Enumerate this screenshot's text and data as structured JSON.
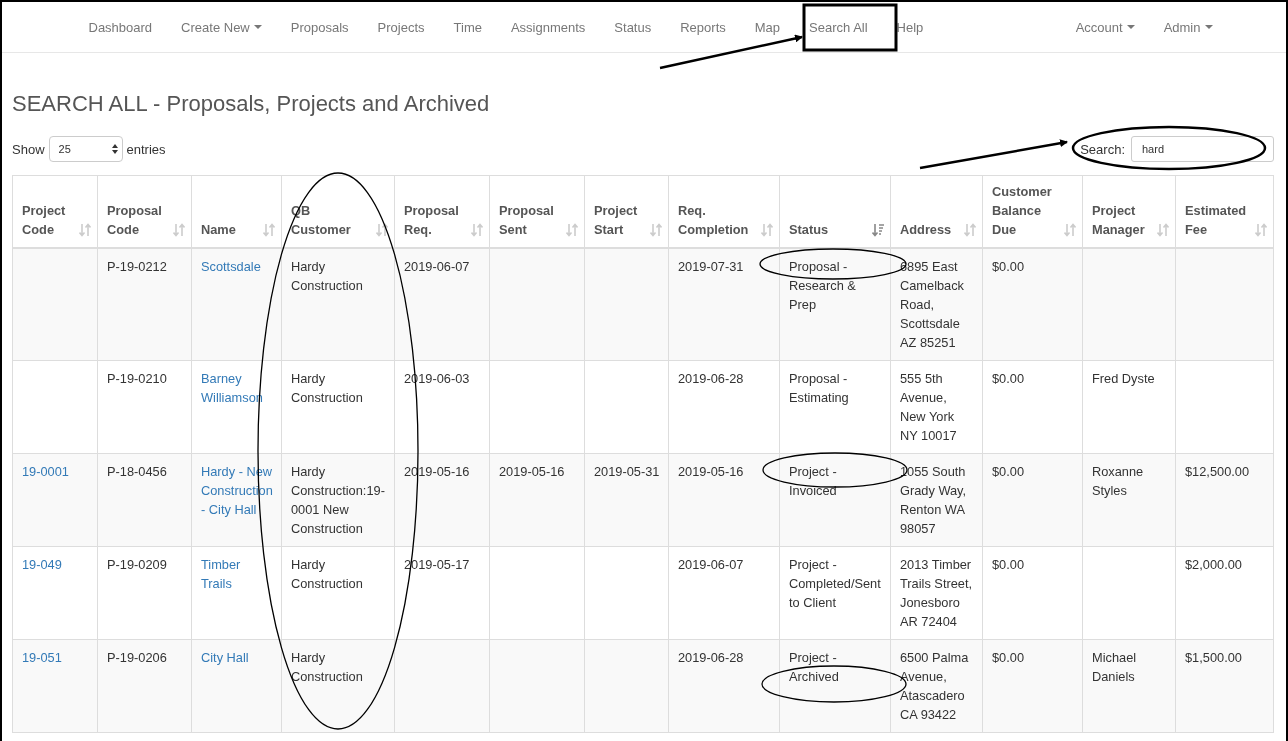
{
  "nav": {
    "items": [
      {
        "label": "Dashboard",
        "dropdown": false
      },
      {
        "label": "Create New",
        "dropdown": true
      },
      {
        "label": "Proposals",
        "dropdown": false
      },
      {
        "label": "Projects",
        "dropdown": false
      },
      {
        "label": "Time",
        "dropdown": false
      },
      {
        "label": "Assignments",
        "dropdown": false
      },
      {
        "label": "Status",
        "dropdown": false
      },
      {
        "label": "Reports",
        "dropdown": false
      },
      {
        "label": "Map",
        "dropdown": false
      },
      {
        "label": "Search All",
        "dropdown": false
      },
      {
        "label": "Help",
        "dropdown": false
      }
    ],
    "right_items": [
      {
        "label": "Account",
        "dropdown": true
      },
      {
        "label": "Admin",
        "dropdown": true
      }
    ]
  },
  "page_title": "SEARCH ALL - Proposals, Projects and Archived",
  "length_control": {
    "label_before": "Show",
    "value": "25",
    "label_after": "entries"
  },
  "search": {
    "label": "Search:",
    "value": "hard"
  },
  "table": {
    "columns": [
      {
        "label": "Project Code",
        "sorted": false
      },
      {
        "label": "Proposal Code",
        "sorted": false
      },
      {
        "label": "Name",
        "sorted": false
      },
      {
        "label": "QB Customer",
        "sorted": false
      },
      {
        "label": "Proposal Req.",
        "sorted": false
      },
      {
        "label": "Proposal Sent",
        "sorted": false
      },
      {
        "label": "Project Start",
        "sorted": false
      },
      {
        "label": "Req. Completion",
        "sorted": false
      },
      {
        "label": "Status",
        "sorted": true
      },
      {
        "label": "Address",
        "sorted": false
      },
      {
        "label": "Customer Balance Due",
        "sorted": false
      },
      {
        "label": "Project Manager",
        "sorted": false
      },
      {
        "label": "Estimated Fee",
        "sorted": false
      }
    ],
    "rows": [
      {
        "proposal_code": "P-19-0212",
        "name": "Scottsdale",
        "qb_customer": "Hardy Construction",
        "proposal_req": "2019-06-07",
        "req_completion": "2019-07-31",
        "status": "Proposal - Research & Prep",
        "address": "6895 East Camelback Road, Scottsdale AZ 85251",
        "balance_due": "$0.00"
      },
      {
        "proposal_code": "P-19-0210",
        "name": "Barney Williamson",
        "qb_customer": "Hardy Construction",
        "proposal_req": "2019-06-03",
        "req_completion": "2019-06-28",
        "status": "Proposal - Estimating",
        "address": "555 5th Avenue, New York NY 10017",
        "balance_due": "$0.00",
        "project_manager": "Fred Dyste"
      },
      {
        "project_code": "19-0001",
        "proposal_code": "P-18-0456",
        "name": "Hardy - New Construction - City Hall",
        "qb_customer": "Hardy Construction:19-0001 New Construction",
        "proposal_req": "2019-05-16",
        "proposal_sent": "2019-05-16",
        "project_start": "2019-05-31",
        "req_completion": "2019-05-16",
        "status": "Project - Invoiced",
        "address": "1055 South Grady Way, Renton WA 98057",
        "balance_due": "$0.00",
        "project_manager": "Roxanne Styles",
        "estimated_fee": "$12,500.00"
      },
      {
        "project_code": "19-049",
        "proposal_code": "P-19-0209",
        "name": "Timber Trails",
        "qb_customer": "Hardy Construction",
        "proposal_req": "2019-05-17",
        "req_completion": "2019-06-07",
        "status": "Project - Completed/Sent to Client",
        "address": "2013 Timber Trails Street, Jonesboro AR 72404",
        "balance_due": "$0.00",
        "estimated_fee": "$2,000.00"
      },
      {
        "project_code": "19-051",
        "proposal_code": "P-19-0206",
        "name": "City Hall",
        "qb_customer": "Hardy Construction",
        "req_completion": "2019-06-28",
        "status": "Project - Archived",
        "address": "6500 Palma Avenue, Atascadero CA 93422",
        "balance_due": "$0.00",
        "project_manager": "Michael Daniels",
        "estimated_fee": "$1,500.00"
      }
    ]
  }
}
